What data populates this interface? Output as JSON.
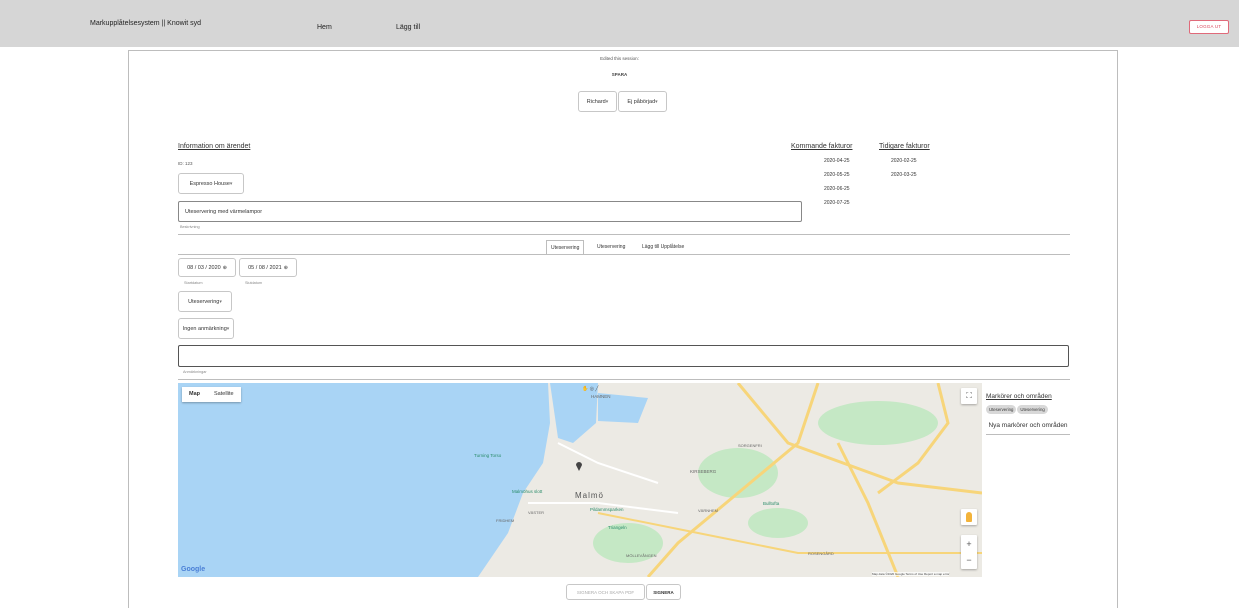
{
  "nav": {
    "brand": "Markupplåtelsesystem || Knowit syd",
    "home": "Hem",
    "add": "Lägg till",
    "logout": "LOGGA UT"
  },
  "session": {
    "edited": "Edited this session:",
    "save": "SPARA",
    "assignee": "Richard",
    "status": "Ej påbörjad"
  },
  "info": {
    "heading": "Information om ärendet",
    "id": "ID: 123",
    "company": "Espresso House",
    "description_value": "Uteservering med värmelampor",
    "description_label": "Beskrivning"
  },
  "invoices": {
    "upcoming_heading": "Kommande fakturor",
    "previous_heading": "Tidigare fakturor",
    "upcoming": [
      "2020-04-25",
      "2020-05-25",
      "2020-06-25",
      "2020-07-25"
    ],
    "previous": [
      "2020-02-25",
      "2020-03-25"
    ]
  },
  "tabs": [
    "Uteservering",
    "Uteservering",
    "Lägg till Upplåtelse"
  ],
  "permit": {
    "start_date": "08 / 03 / 2020",
    "start_label": "Startdatum",
    "end_date": "05 / 08 / 2021",
    "end_label": "Slutdatum",
    "type": "Uteservering",
    "notice": "Ingen anmärkning",
    "notes_label": "Anmärkningar",
    "notes_value": ""
  },
  "map": {
    "type_map": "Map",
    "type_satellite": "Satellite",
    "city": "Malmö",
    "districts": [
      "HAMNEN",
      "KIRSEBERG",
      "FRIDHEM",
      "VÄSTER",
      "MÖLLEVÅNGEN",
      "ROSENGÅRD",
      "VÄRNHEM",
      "SORGENFRI"
    ],
    "pois": [
      "Turning Torso",
      "Malmöhus slott",
      "Pildammsparken",
      "Triangeln",
      "Bulltofta"
    ],
    "zoom_in": "+",
    "zoom_out": "−",
    "google": "Google",
    "footer": "Map data ©2020 Google   Terms of Use   Report a map error"
  },
  "markers": {
    "heading": "Markörer och områden",
    "pills": [
      "Uteservering",
      "Uteservering"
    ],
    "new_heading": "Nya markörer och områden"
  },
  "footer": {
    "sign_pdf": "SIGNERA OCH SKAPA PDF",
    "sign": "SIGNERA"
  },
  "colors": {
    "topbar": "#d6d6d6",
    "logout": "#d9455b",
    "water": "#a9d4f5",
    "land": "#eceae4",
    "park": "#c5e8c5",
    "road": "#f7d57a"
  }
}
